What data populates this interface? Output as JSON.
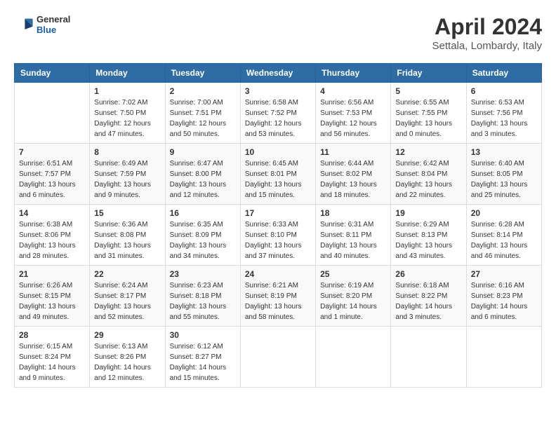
{
  "header": {
    "logo": {
      "general": "General",
      "blue": "Blue"
    },
    "title": "April 2024",
    "location": "Settala, Lombardy, Italy"
  },
  "columns": [
    "Sunday",
    "Monday",
    "Tuesday",
    "Wednesday",
    "Thursday",
    "Friday",
    "Saturday"
  ],
  "weeks": [
    {
      "days": [
        {
          "num": "",
          "info": ""
        },
        {
          "num": "1",
          "info": "Sunrise: 7:02 AM\nSunset: 7:50 PM\nDaylight: 12 hours\nand 47 minutes."
        },
        {
          "num": "2",
          "info": "Sunrise: 7:00 AM\nSunset: 7:51 PM\nDaylight: 12 hours\nand 50 minutes."
        },
        {
          "num": "3",
          "info": "Sunrise: 6:58 AM\nSunset: 7:52 PM\nDaylight: 12 hours\nand 53 minutes."
        },
        {
          "num": "4",
          "info": "Sunrise: 6:56 AM\nSunset: 7:53 PM\nDaylight: 12 hours\nand 56 minutes."
        },
        {
          "num": "5",
          "info": "Sunrise: 6:55 AM\nSunset: 7:55 PM\nDaylight: 13 hours\nand 0 minutes."
        },
        {
          "num": "6",
          "info": "Sunrise: 6:53 AM\nSunset: 7:56 PM\nDaylight: 13 hours\nand 3 minutes."
        }
      ]
    },
    {
      "days": [
        {
          "num": "7",
          "info": "Sunrise: 6:51 AM\nSunset: 7:57 PM\nDaylight: 13 hours\nand 6 minutes."
        },
        {
          "num": "8",
          "info": "Sunrise: 6:49 AM\nSunset: 7:59 PM\nDaylight: 13 hours\nand 9 minutes."
        },
        {
          "num": "9",
          "info": "Sunrise: 6:47 AM\nSunset: 8:00 PM\nDaylight: 13 hours\nand 12 minutes."
        },
        {
          "num": "10",
          "info": "Sunrise: 6:45 AM\nSunset: 8:01 PM\nDaylight: 13 hours\nand 15 minutes."
        },
        {
          "num": "11",
          "info": "Sunrise: 6:44 AM\nSunset: 8:02 PM\nDaylight: 13 hours\nand 18 minutes."
        },
        {
          "num": "12",
          "info": "Sunrise: 6:42 AM\nSunset: 8:04 PM\nDaylight: 13 hours\nand 22 minutes."
        },
        {
          "num": "13",
          "info": "Sunrise: 6:40 AM\nSunset: 8:05 PM\nDaylight: 13 hours\nand 25 minutes."
        }
      ]
    },
    {
      "days": [
        {
          "num": "14",
          "info": "Sunrise: 6:38 AM\nSunset: 8:06 PM\nDaylight: 13 hours\nand 28 minutes."
        },
        {
          "num": "15",
          "info": "Sunrise: 6:36 AM\nSunset: 8:08 PM\nDaylight: 13 hours\nand 31 minutes."
        },
        {
          "num": "16",
          "info": "Sunrise: 6:35 AM\nSunset: 8:09 PM\nDaylight: 13 hours\nand 34 minutes."
        },
        {
          "num": "17",
          "info": "Sunrise: 6:33 AM\nSunset: 8:10 PM\nDaylight: 13 hours\nand 37 minutes."
        },
        {
          "num": "18",
          "info": "Sunrise: 6:31 AM\nSunset: 8:11 PM\nDaylight: 13 hours\nand 40 minutes."
        },
        {
          "num": "19",
          "info": "Sunrise: 6:29 AM\nSunset: 8:13 PM\nDaylight: 13 hours\nand 43 minutes."
        },
        {
          "num": "20",
          "info": "Sunrise: 6:28 AM\nSunset: 8:14 PM\nDaylight: 13 hours\nand 46 minutes."
        }
      ]
    },
    {
      "days": [
        {
          "num": "21",
          "info": "Sunrise: 6:26 AM\nSunset: 8:15 PM\nDaylight: 13 hours\nand 49 minutes."
        },
        {
          "num": "22",
          "info": "Sunrise: 6:24 AM\nSunset: 8:17 PM\nDaylight: 13 hours\nand 52 minutes."
        },
        {
          "num": "23",
          "info": "Sunrise: 6:23 AM\nSunset: 8:18 PM\nDaylight: 13 hours\nand 55 minutes."
        },
        {
          "num": "24",
          "info": "Sunrise: 6:21 AM\nSunset: 8:19 PM\nDaylight: 13 hours\nand 58 minutes."
        },
        {
          "num": "25",
          "info": "Sunrise: 6:19 AM\nSunset: 8:20 PM\nDaylight: 14 hours\nand 1 minute."
        },
        {
          "num": "26",
          "info": "Sunrise: 6:18 AM\nSunset: 8:22 PM\nDaylight: 14 hours\nand 3 minutes."
        },
        {
          "num": "27",
          "info": "Sunrise: 6:16 AM\nSunset: 8:23 PM\nDaylight: 14 hours\nand 6 minutes."
        }
      ]
    },
    {
      "days": [
        {
          "num": "28",
          "info": "Sunrise: 6:15 AM\nSunset: 8:24 PM\nDaylight: 14 hours\nand 9 minutes."
        },
        {
          "num": "29",
          "info": "Sunrise: 6:13 AM\nSunset: 8:26 PM\nDaylight: 14 hours\nand 12 minutes."
        },
        {
          "num": "30",
          "info": "Sunrise: 6:12 AM\nSunset: 8:27 PM\nDaylight: 14 hours\nand 15 minutes."
        },
        {
          "num": "",
          "info": ""
        },
        {
          "num": "",
          "info": ""
        },
        {
          "num": "",
          "info": ""
        },
        {
          "num": "",
          "info": ""
        }
      ]
    }
  ]
}
